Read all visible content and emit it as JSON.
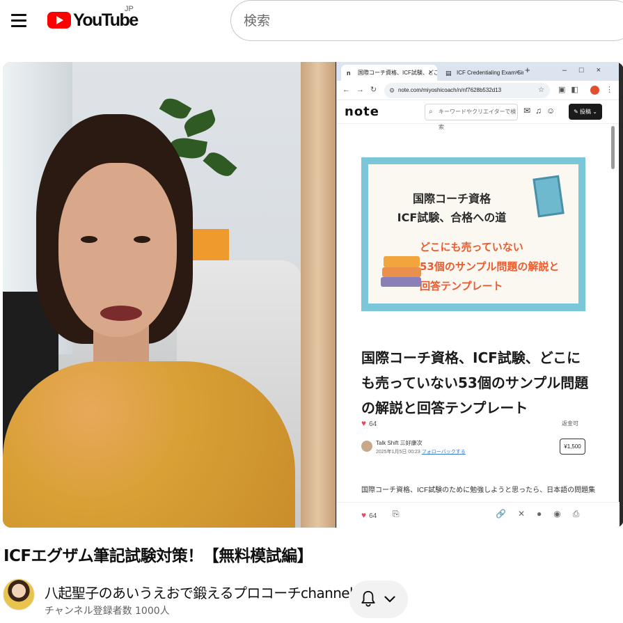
{
  "header": {
    "logo_text": "YouTube",
    "region": "JP",
    "search_placeholder": "検索"
  },
  "video": {
    "browser": {
      "tabs": [
        {
          "favicon": "n",
          "label": "国際コーチ資格、ICF試験、どこにも",
          "close": "×"
        },
        {
          "favicon": "▤",
          "label": "ICF Credentialing Exam Simulat",
          "close": "×"
        }
      ],
      "new_tab": "+",
      "window_controls": "–□×",
      "url": "note.com/miyoshicoach/n/nf7628b532d13"
    },
    "note": {
      "logo": "note",
      "search_placeholder": "キーワードやクリエイターで検索",
      "post_label": "投稿",
      "banner": {
        "line1": "国際コーチ資格",
        "line2": "ICF試験、合格への道",
        "line3": "どこにも売っていない",
        "line4": "53個のサンプル問題の解説と",
        "line5": "回答テンプレート"
      },
      "article_title": "国際コーチ資格、ICF試験、どこにも売っていない53個のサンプル問題の解説と回答テンプレート",
      "likes": "64",
      "tokutei": "返金可",
      "author": "Talk Shift 三好康次",
      "date": "2025年1月5日 00:23",
      "follow_label": "フォローバックする",
      "price": "¥1,500",
      "excerpt": "国際コーチ資格、ICF試験のために勉強しようと思ったら、日本語の問題集",
      "footer_likes": "64"
    }
  },
  "info": {
    "title": "ICFエグザム筆記試験対策！【無料模試編】",
    "channel_name": "八起聖子のあいうえおで鍛えるプロコーチchannel",
    "subscribers": "チャンネル登録者数 1000人"
  },
  "colors": {
    "youtube_red": "#ff0000",
    "banner_frame": "#7cc6d9",
    "banner_accent": "#ea5b2e"
  }
}
